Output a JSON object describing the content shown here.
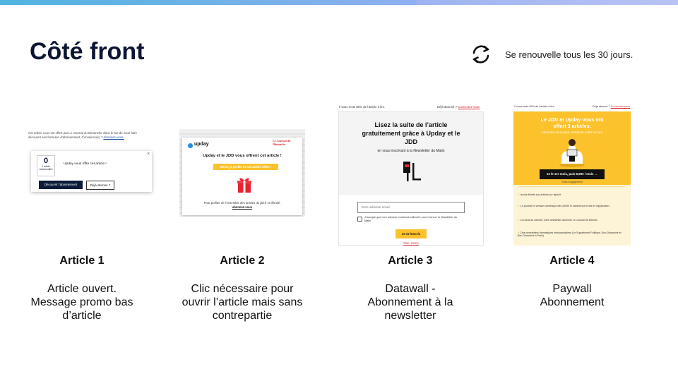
{
  "header": {
    "title": "Côté front"
  },
  "renewal": {
    "icon": "refresh-icon",
    "text": "Se renouvelle tous les 30 jours."
  },
  "articles": [
    {
      "title": "Article 1",
      "description": "Article ouvert. Message promo bas d’article"
    },
    {
      "title": "Article 2",
      "description": "Clic nécessaire pour ouvrir l’article mais sans contrepartie"
    },
    {
      "title": "Article 3",
      "description": "Datawall - Abonnement à la newsletter"
    },
    {
      "title": "Article 4",
      "description": "Paywall Abonnement"
    }
  ],
  "mock1": {
    "intro": "Cet article vous est offert par Le Journal du Dimanche dans le but de vous faire découvrir ses formules d’abonnement. Convaincu(e) ?",
    "intro_link": "Abonnez-vous.",
    "count": "0",
    "count_label": "1 article restant offert",
    "offer": "Upday vous offre cet article !",
    "discover_button": "Découvrir l’abonnement",
    "already_button": "Déjà abonné ?",
    "close": "×"
  },
  "mock2": {
    "upday": "upday",
    "jdd_logo": "Le Journal du Dimanche",
    "headline": "Upday et le JDD vous offrent cet article !",
    "button": "Merci, je profite de cet article offert !",
    "footer": "Pour profiter de l’ensemble des articles du jdd.fr en illimité,",
    "footer_link": "abonnez-vous"
  },
  "mock3": {
    "top_left": "Il vous reste 80% de l’article à lire.",
    "top_right": "Déjà abonné ?",
    "top_link": "Connectez-vous",
    "headline": "Lisez la suite de l’article gratuitement grâce à Upday et le JDD",
    "sub": "en vous inscrivant à la Newsletter du Matin",
    "email_placeholder": "Votre adresse email",
    "consent": "J’accepte que mon adresse email soit collectée pour recevoir la Newsletter du Matin",
    "submit": "Je m’inscris",
    "decline": "Non, merci"
  },
  "mock4": {
    "top_left": "Il vous reste 80% de l’article à lire.",
    "top_right": "Déjà abonné ?",
    "top_link": "Connectez-vous",
    "headline": "Le JDD et Upday vous ont offert 3 articles.",
    "sub": "Abonnez-vous pour continuer votre lecture",
    "offer_button": "1€ le 1er mois, puis 6,90€ / mois →",
    "no_commit": "Sans engagement",
    "benefits": [
      "Accès illimité aux articles sur lejdd.fr",
      "Le journal en version numérique dès 20h00 le samedi sur le site et l’application",
      "Du lundi au samedi, votre newsletter abonnés Le Journal de Demain",
      "Des newsletters thématiques hebdomadaires (Le Supplément Politique, Bon Dimanche et Bon Dimanche à Paris)"
    ]
  },
  "colors": {
    "navy": "#0b1533",
    "yellow": "#fcc22c",
    "cream": "#fdf3d6",
    "upday_blue": "#1e90e8",
    "jdd_red": "#d5232a",
    "link_red": "#d5232a"
  }
}
